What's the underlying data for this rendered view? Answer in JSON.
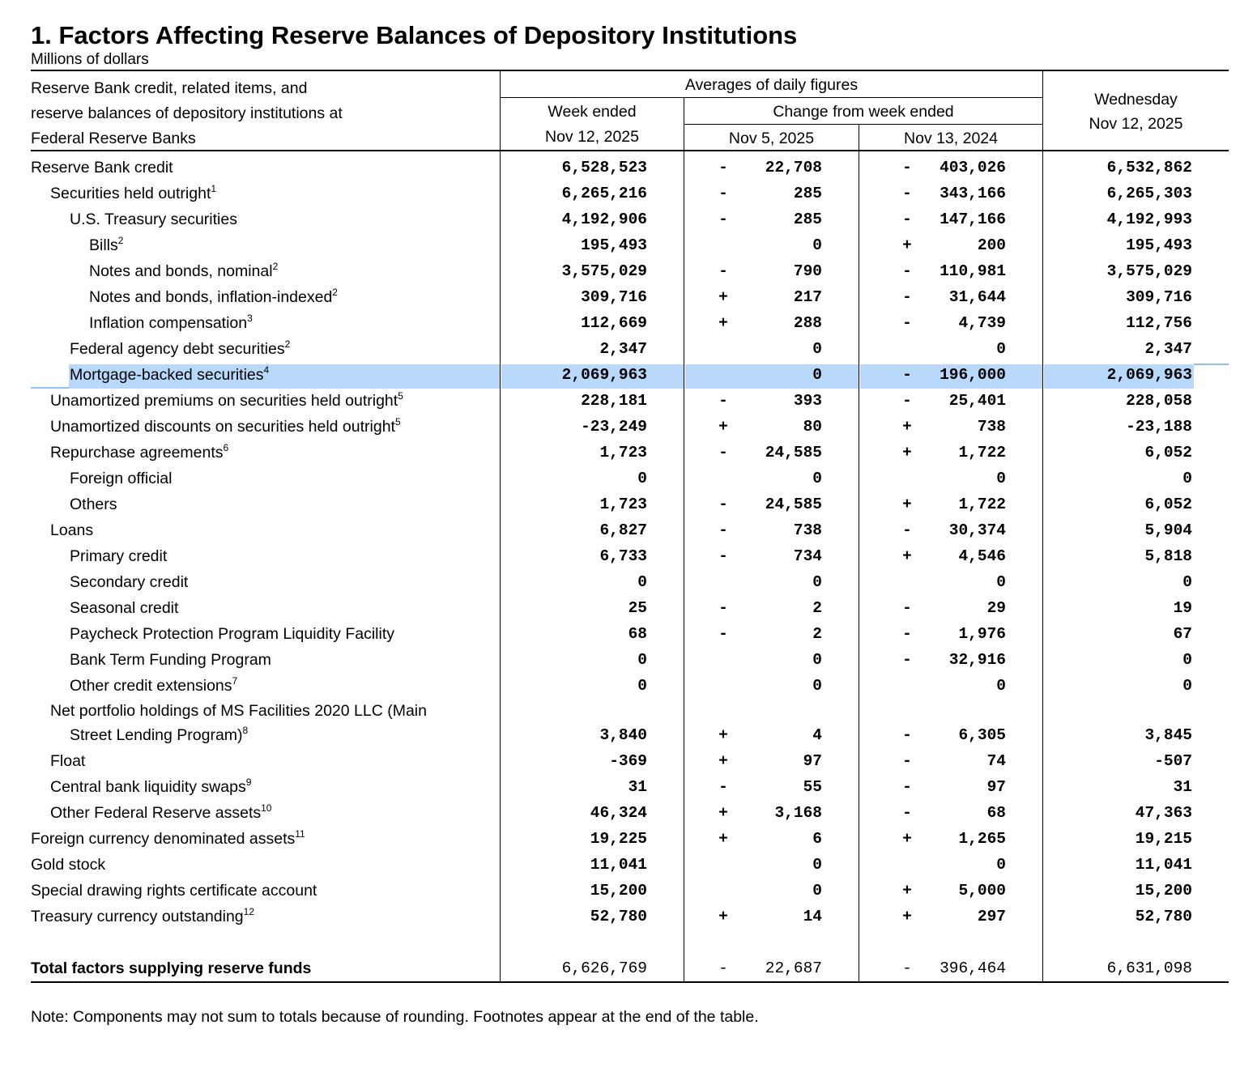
{
  "title": "1. Factors Affecting Reserve Balances of Depository Institutions",
  "units": "Millions of dollars",
  "header": {
    "stub": [
      "Reserve Bank credit, related items, and",
      "reserve balances of depository institutions at",
      "Federal Reserve Banks"
    ],
    "averages": "Averages of daily figures",
    "week_ended": "Week ended",
    "week_ended_date": "Nov 12, 2025",
    "change_from": "Change from week ended",
    "change_date_1": "Nov 5, 2025",
    "change_date_2": "Nov 13, 2024",
    "wednesday": "Wednesday",
    "wednesday_date": "Nov 12, 2025"
  },
  "highlight_color": "#b8d8fc",
  "rows": [
    {
      "label": "Reserve Bank credit",
      "fn": "",
      "week": "6,528,523",
      "s1": "-",
      "c1": "22,708",
      "s2": "-",
      "c2": "403,026",
      "wed": "6,532,862"
    },
    {
      "label": "Securities held outright",
      "fn": "1",
      "week": "6,265,216",
      "s1": "-",
      "c1": "285",
      "s2": "-",
      "c2": "343,166",
      "wed": "6,265,303"
    },
    {
      "label": "U.S. Treasury securities",
      "fn": "",
      "week": "4,192,906",
      "s1": "-",
      "c1": "285",
      "s2": "-",
      "c2": "147,166",
      "wed": "4,192,993"
    },
    {
      "label": "Bills",
      "fn": "2",
      "week": "195,493",
      "s1": "",
      "c1": "0",
      "s2": "+",
      "c2": "200",
      "wed": "195,493"
    },
    {
      "label": "Notes and bonds, nominal",
      "fn": "2",
      "week": "3,575,029",
      "s1": "-",
      "c1": "790",
      "s2": "-",
      "c2": "110,981",
      "wed": "3,575,029"
    },
    {
      "label": "Notes and bonds, inflation-indexed",
      "fn": "2",
      "week": "309,716",
      "s1": "+",
      "c1": "217",
      "s2": "-",
      "c2": "31,644",
      "wed": "309,716"
    },
    {
      "label": "Inflation compensation",
      "fn": "3",
      "week": "112,669",
      "s1": "+",
      "c1": "288",
      "s2": "-",
      "c2": "4,739",
      "wed": "112,756"
    },
    {
      "label": "Federal agency debt securities",
      "fn": "2",
      "week": "2,347",
      "s1": "",
      "c1": "0",
      "s2": "",
      "c2": "0",
      "wed": "2,347"
    },
    {
      "label": "Mortgage-backed securities",
      "fn": "4",
      "week": "2,069,963",
      "s1": "",
      "c1": "0",
      "s2": "-",
      "c2": "196,000",
      "wed": "2,069,963"
    },
    {
      "label": "Unamortized premiums on securities held outright",
      "fn": "5",
      "week": "228,181",
      "s1": "-",
      "c1": "393",
      "s2": "-",
      "c2": "25,401",
      "wed": "228,058"
    },
    {
      "label": "Unamortized discounts on securities held outright",
      "fn": "5",
      "week": "-23,249",
      "s1": "+",
      "c1": "80",
      "s2": "+",
      "c2": "738",
      "wed": "-23,188"
    },
    {
      "label": "Repurchase agreements",
      "fn": "6",
      "week": "1,723",
      "s1": "-",
      "c1": "24,585",
      "s2": "+",
      "c2": "1,722",
      "wed": "6,052"
    },
    {
      "label": "Foreign official",
      "fn": "",
      "week": "0",
      "s1": "",
      "c1": "0",
      "s2": "",
      "c2": "0",
      "wed": "0"
    },
    {
      "label": "Others",
      "fn": "",
      "week": "1,723",
      "s1": "-",
      "c1": "24,585",
      "s2": "+",
      "c2": "1,722",
      "wed": "6,052"
    },
    {
      "label": "Loans",
      "fn": "",
      "week": "6,827",
      "s1": "-",
      "c1": "738",
      "s2": "-",
      "c2": "30,374",
      "wed": "5,904"
    },
    {
      "label": "Primary credit",
      "fn": "",
      "week": "6,733",
      "s1": "-",
      "c1": "734",
      "s2": "+",
      "c2": "4,546",
      "wed": "5,818"
    },
    {
      "label": "Secondary credit",
      "fn": "",
      "week": "0",
      "s1": "",
      "c1": "0",
      "s2": "",
      "c2": "0",
      "wed": "0"
    },
    {
      "label": "Seasonal credit",
      "fn": "",
      "week": "25",
      "s1": "-",
      "c1": "2",
      "s2": "-",
      "c2": "29",
      "wed": "19"
    },
    {
      "label": "Paycheck Protection Program Liquidity Facility",
      "fn": "",
      "week": "68",
      "s1": "-",
      "c1": "2",
      "s2": "-",
      "c2": "1,976",
      "wed": "67"
    },
    {
      "label": "Bank Term Funding Program",
      "fn": "",
      "week": "0",
      "s1": "",
      "c1": "0",
      "s2": "-",
      "c2": "32,916",
      "wed": "0"
    },
    {
      "label": "Other credit extensions",
      "fn": "7",
      "week": "0",
      "s1": "",
      "c1": "0",
      "s2": "",
      "c2": "0",
      "wed": "0"
    },
    {
      "label": "Net portfolio holdings of MS Facilities 2020 LLC (Main",
      "fn": "",
      "week": "",
      "s1": "",
      "c1": "",
      "s2": "",
      "c2": "",
      "wed": ""
    },
    {
      "label": "Street Lending Program)",
      "fn": "8",
      "week": "3,840",
      "s1": "+",
      "c1": "4",
      "s2": "-",
      "c2": "6,305",
      "wed": "3,845"
    },
    {
      "label": "Float",
      "fn": "",
      "week": "-369",
      "s1": "+",
      "c1": "97",
      "s2": "-",
      "c2": "74",
      "wed": "-507"
    },
    {
      "label": "Central bank liquidity swaps",
      "fn": "9",
      "week": "31",
      "s1": "-",
      "c1": "55",
      "s2": "-",
      "c2": "97",
      "wed": "31"
    },
    {
      "label": "Other Federal Reserve assets",
      "fn": "10",
      "week": "46,324",
      "s1": "+",
      "c1": "3,168",
      "s2": "-",
      "c2": "68",
      "wed": "47,363"
    },
    {
      "label": "Foreign currency denominated assets",
      "fn": "11",
      "week": "19,225",
      "s1": "+",
      "c1": "6",
      "s2": "+",
      "c2": "1,265",
      "wed": "19,215"
    },
    {
      "label": "Gold stock",
      "fn": "",
      "week": "11,041",
      "s1": "",
      "c1": "0",
      "s2": "",
      "c2": "0",
      "wed": "11,041"
    },
    {
      "label": "Special drawing rights certificate account",
      "fn": "",
      "week": "15,200",
      "s1": "",
      "c1": "0",
      "s2": "+",
      "c2": "5,000",
      "wed": "15,200"
    },
    {
      "label": "Treasury currency outstanding",
      "fn": "12",
      "week": "52,780",
      "s1": "+",
      "c1": "14",
      "s2": "+",
      "c2": "297",
      "wed": "52,780"
    }
  ],
  "total": {
    "label": "Total factors supplying reserve funds",
    "week": "6,626,769",
    "s1": "-",
    "c1": "22,687",
    "s2": "-",
    "c2": "396,464",
    "wed": "6,631,098"
  },
  "note": "Note: Components may not sum to totals because of rounding. Footnotes appear at the end of the table."
}
